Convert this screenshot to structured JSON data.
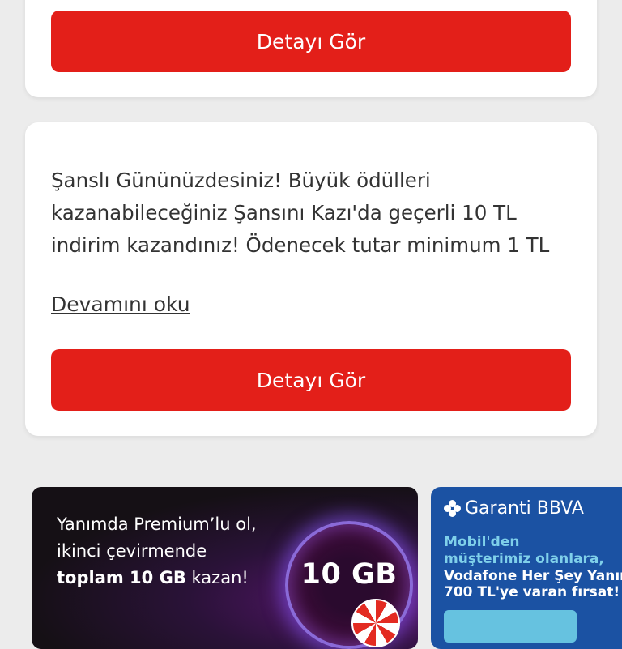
{
  "top_card": {
    "button_label": "Detayı Gör"
  },
  "offer_card": {
    "message": "Şanslı Gününüzdesiniz! Büyük ödülleri kazanabileceğiniz Şansını Kazı'da geçerli 10 TL indirim kazandınız! Ödenecek tutar minimum 1 TL",
    "read_more_label": "Devamını oku",
    "button_label": "Detayı Gör"
  },
  "banners": {
    "premium": {
      "line1": "Yanımda Premium’lu ol,",
      "line2": "ikinci çevirmende",
      "line3_bold": "toplam 10 GB",
      "line3_rest": " kazan!",
      "badge": "10 GB"
    },
    "garanti": {
      "logo_text": "Garanti BBVA",
      "line1": "Mobil'den",
      "line2": "müşterimiz olanlara,",
      "line3": "Vodafone Her Şey Yanımda",
      "line4": "700 TL'ye varan fırsat!"
    }
  },
  "colors": {
    "primary_red": "#e31f19",
    "background": "#ececec",
    "garanti_blue": "#1b52a3",
    "garanti_accent": "#7fd0ea"
  }
}
